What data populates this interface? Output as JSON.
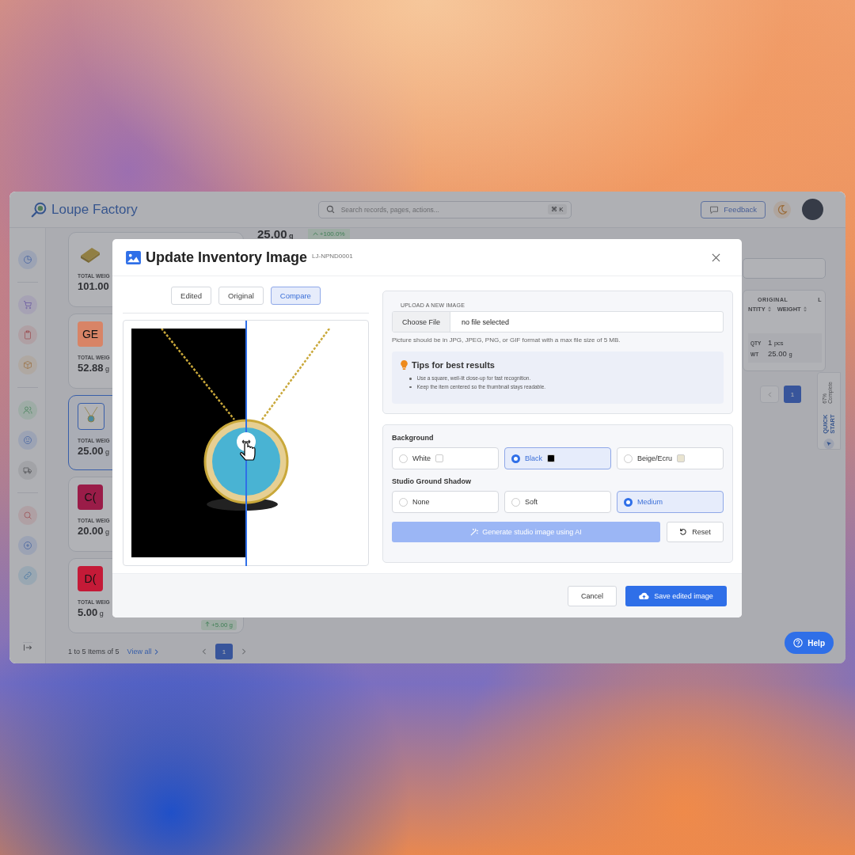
{
  "app": {
    "logo": "Loupe Factory",
    "search_placeholder": "Search records, pages, actions...",
    "shortcut": "⌘ K",
    "feedback": "Feedback"
  },
  "summary": {
    "value": "25.00",
    "unit": "g",
    "change": "+100.0%"
  },
  "cards": [
    {
      "kind": "bar",
      "label": "TOTAL WEIG",
      "value": "101.00",
      "selected": false
    },
    {
      "kind": "initials",
      "initials": "GE",
      "color": "#d88466",
      "label": "TOTAL WEIG",
      "value": "52.88",
      "unit": "g",
      "selected": false
    },
    {
      "kind": "necklace",
      "label": "TOTAL WEIG",
      "value": "25.00",
      "unit": "g",
      "selected": true
    },
    {
      "kind": "initials",
      "initials": "C(",
      "color": "#9a1c48",
      "label": "TOTAL WEIG",
      "value": "20.00",
      "unit": "g",
      "selected": false
    },
    {
      "kind": "initials",
      "initials": "D(",
      "color": "#c41a37",
      "label": "TOTAL WEIG",
      "value": "5.00",
      "unit": "g",
      "selected": false,
      "badge": "+5.00 g"
    }
  ],
  "list_footer": {
    "range": "1 to 5 Items of 5",
    "link": "View all",
    "pages": [
      {
        "label": "1",
        "selected": true
      }
    ]
  },
  "table": {
    "group_heading": "ORIGINAL",
    "columns": [
      "NTITY",
      "WEIGHT"
    ],
    "cut_column": "L",
    "rows": [
      {
        "label": "QTY",
        "value": "1",
        "unit": "pcs"
      },
      {
        "label": "WT",
        "value": "25.00",
        "unit": "g"
      }
    ],
    "pages": [
      {
        "label": "1",
        "selected": true
      }
    ]
  },
  "quick_start": {
    "title": "QUICK START",
    "progress": "67% Complete"
  },
  "help": "Help",
  "modal": {
    "title": "Update Inventory Image",
    "code": "LJ-NPND0001",
    "view_tabs": [
      {
        "label": "Edited",
        "selected": false
      },
      {
        "label": "Original",
        "selected": false
      },
      {
        "label": "Compare",
        "selected": true
      }
    ],
    "upload": {
      "label": "UPLOAD A NEW IMAGE",
      "button": "Choose File",
      "value": "no file selected",
      "hint": "Picture should be in JPG, JPEG, PNG, or GIF format with a max file size of 5 MB."
    },
    "tips": {
      "title": "Tips for best results",
      "items": [
        "Use a square, well-lit close-up for fast recognition.",
        "Keep the item centered so the thumbnail stays readable."
      ]
    },
    "option_groups": [
      {
        "title": "Background",
        "options": [
          {
            "label": "White",
            "selected": false,
            "color": "#ffffff"
          },
          {
            "label": "Black",
            "selected": true,
            "color": "#000000"
          },
          {
            "label": "Beige/Ecru",
            "selected": false,
            "color": "#e9e4d0"
          }
        ]
      },
      {
        "title": "Studio Ground Shadow",
        "options": [
          {
            "label": "None",
            "selected": false
          },
          {
            "label": "Soft",
            "selected": false
          },
          {
            "label": "Medium",
            "selected": true
          }
        ]
      }
    ],
    "generate": {
      "label": "Generate studio image using AI",
      "disabled": true
    },
    "reset": "Reset",
    "cancel": "Cancel",
    "save": "Save edited image"
  }
}
